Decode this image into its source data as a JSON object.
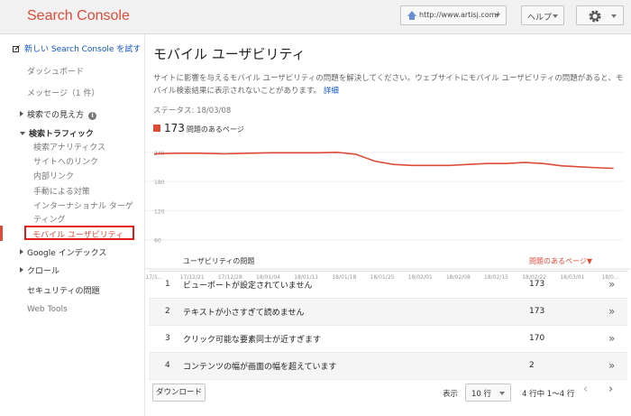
{
  "header": {
    "logo": "Search Console",
    "site": "http://www.artisj.com/",
    "help_label": "ヘルプ"
  },
  "sidebar": {
    "new_search_console": "新しい Search Console を試す",
    "dashboard": "ダッシュボード",
    "messages": "メッセージ（1 件）",
    "search_appearance": "検索での見え方",
    "info_badge": "i",
    "search_traffic": "検索トラフィック",
    "search_analytics": "検索アナリティクス",
    "links_to_site": "サイトへのリンク",
    "internal_links": "内部リンク",
    "manual_actions": "手動による対策",
    "international_targeting_1": "インターナショナル ターゲ",
    "international_targeting_2": "ティング",
    "mobile_usability": "モバイル ユーザビリティ",
    "google_index": "Google インデックス",
    "crawl": "クロール",
    "security_issues": "セキュリティの問題",
    "web_tools": "Web Tools"
  },
  "main": {
    "title": "モバイル ユーザビリティ",
    "description": "サイトに影響を与えるモバイル ユーザビリティの問題を解決してください。ウェブサイトにモバイル ユーザビリティの問題があると、モバイル検索結果に表示されないことがあります。",
    "details_link": "詳細",
    "status": "ステータス: 18/03/08",
    "issues_count": "173",
    "issues_label": "問題のあるページ",
    "table": {
      "col_issue": "ユーザビリティの問題",
      "col_pages": "問題のあるページ▼",
      "rows": [
        {
          "num": "1",
          "name": "ビューポートが設定されていません",
          "value": "173"
        },
        {
          "num": "2",
          "name": "テキストが小さすぎて読めません",
          "value": "173"
        },
        {
          "num": "3",
          "name": "クリック可能な要素同士が近すぎます",
          "value": "170"
        },
        {
          "num": "4",
          "name": "コンテンツの幅が画面の幅を超えています",
          "value": "2"
        }
      ]
    },
    "footer": {
      "download": "ダウンロード",
      "show_label": "表示",
      "rows_per_page": "10 行",
      "range": "4 行中 1〜4 行",
      "prev": "‹",
      "next": "›"
    }
  },
  "colors": {
    "accent": "#dd4b39",
    "link": "#1155cc",
    "highlight_box": "#e31b1b"
  },
  "chart_data": {
    "type": "line",
    "x": [
      "17/1...",
      "17/12/21",
      "17/12/28",
      "18/01/04",
      "18/01/11",
      "18/01/18",
      "18/01/25",
      "18/02/01",
      "18/02/08",
      "18/02/15",
      "18/02/22",
      "18/03/01",
      "18/0..."
    ],
    "series": [
      {
        "name": "問題のあるページ",
        "color": "#dd4b39",
        "points": [
          [
            0,
            237
          ],
          [
            5,
            238
          ],
          [
            10,
            238
          ],
          [
            15,
            237
          ],
          [
            20,
            238
          ],
          [
            25,
            239
          ],
          [
            30,
            239
          ],
          [
            35,
            239
          ],
          [
            39,
            240
          ],
          [
            43,
            236
          ],
          [
            47,
            222
          ],
          [
            51,
            215
          ],
          [
            55,
            213
          ],
          [
            59,
            213
          ],
          [
            63,
            213
          ],
          [
            67,
            215
          ],
          [
            71,
            217
          ],
          [
            75,
            217
          ],
          [
            79,
            219
          ],
          [
            83,
            217
          ],
          [
            87,
            212
          ],
          [
            91,
            210
          ],
          [
            95,
            208
          ],
          [
            98,
            207
          ]
        ]
      }
    ],
    "yticks": [
      240,
      180,
      120,
      60
    ],
    "ylim": [
      0,
      260
    ],
    "xlim": [
      0,
      100
    ]
  }
}
